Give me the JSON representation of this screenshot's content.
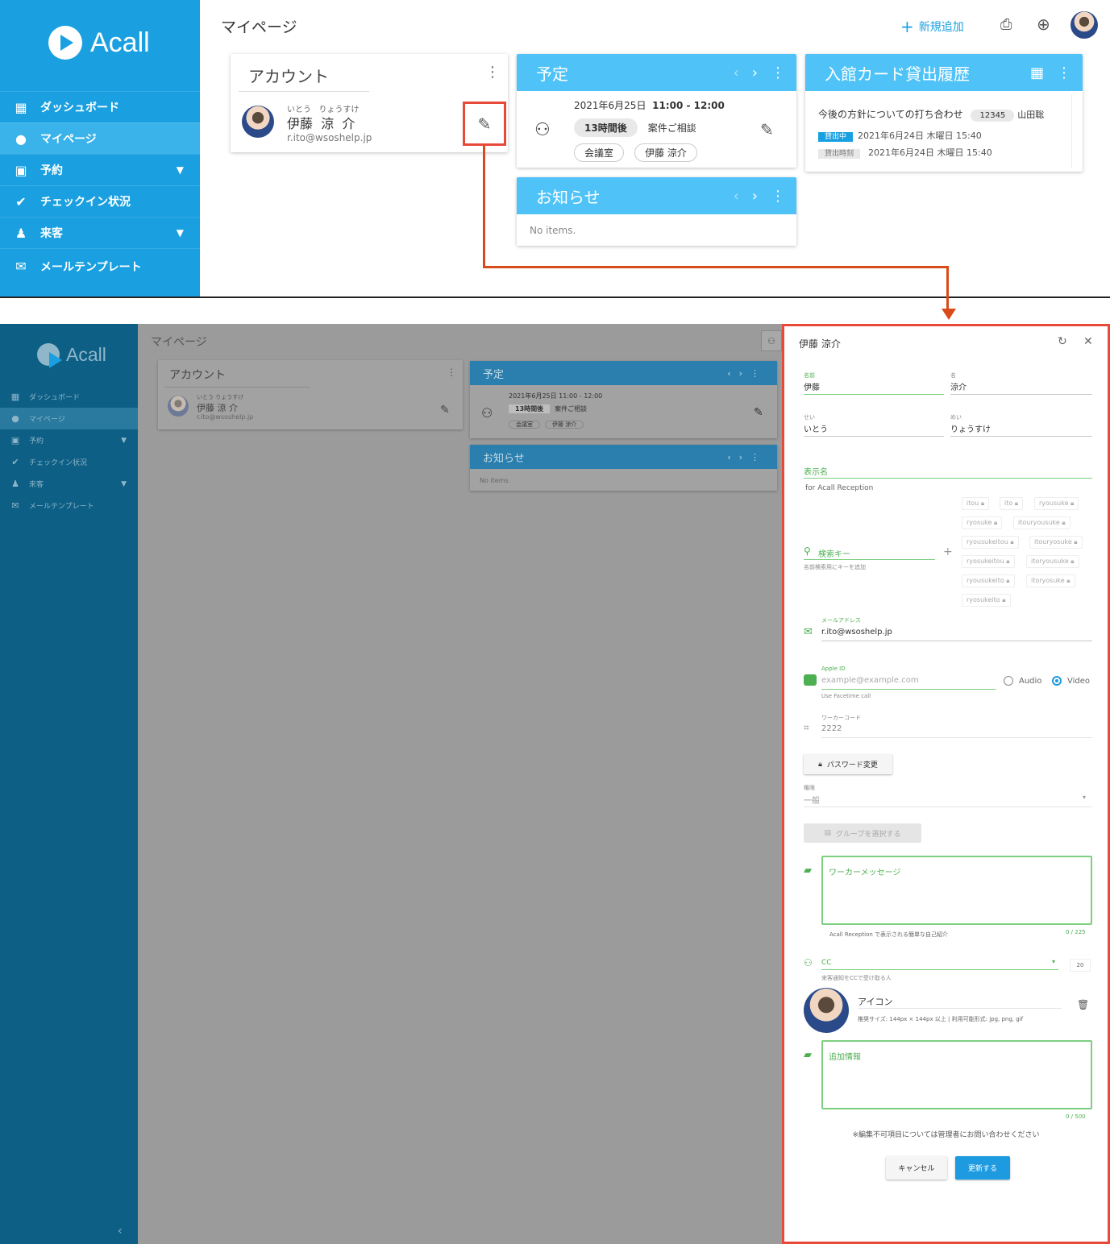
{
  "app": {
    "brand": "Acall",
    "page_title": "マイページ"
  },
  "header": {
    "new_label": "新規追加"
  },
  "sidebar": {
    "items": [
      {
        "label": "ダッシュボード",
        "icon": "dashboard-icon"
      },
      {
        "label": "マイページ",
        "icon": "account-icon"
      },
      {
        "label": "予約",
        "icon": "calendar-icon"
      },
      {
        "label": "チェックイン状況",
        "icon": "check-icon"
      },
      {
        "label": "来客",
        "icon": "visitor-icon"
      },
      {
        "label": "メールテンプレート",
        "icon": "mail-icon"
      }
    ]
  },
  "account": {
    "title": "アカウント",
    "kana_last": "いとう",
    "kana_first": "りょうすけ",
    "name_last": "伊藤",
    "name_first": "涼",
    "name_first2": "介",
    "email": "r.ito@wsoshelp.jp"
  },
  "schedule": {
    "title": "予定",
    "date": "2021年6月25日",
    "time": "11:00 - 12:00",
    "badge": "13時間後",
    "subject": "案件ご相談",
    "room": "会議室",
    "person": "伊藤 涼介"
  },
  "notice": {
    "title": "お知らせ",
    "empty": "No items."
  },
  "card_history": {
    "title": "入館カード貸出履歴",
    "meeting": "今後の方針についての打ち合わせ",
    "card_no": "12345",
    "person": "山田聡",
    "status": "貸出中",
    "status_date": "2021年6月24日 木曜日 15:40",
    "lend_label": "貸出時刻",
    "lend_date": "2021年6月24日 木曜日 15:40"
  },
  "dim_account": {
    "kana": "いとう りょうすけ",
    "name": "伊藤 涼 介",
    "schedule_datetime": "2021年6月25日 11:00 - 12:00",
    "room": "会議室",
    "person": "伊藤 涼介"
  },
  "form": {
    "title": "伊藤 涼介",
    "last_label": "名前",
    "last_value": "伊藤",
    "first_label": "名",
    "first_value": "涼介",
    "sei_label": "せい",
    "sei_value": "いとう",
    "mei_label": "めい",
    "mei_value": "りょうすけ",
    "display_label": "表示名",
    "display_hint": "for Acall Reception",
    "search_label": "検索キー",
    "search_hint": "名前検索用にキーを追加",
    "search_keys": [
      "itou",
      "ito",
      "ryousuke",
      "ryosuke",
      "itouryousuke",
      "ryousukeitou",
      "itouryosuke",
      "ryosukeitou",
      "itoryousuke",
      "ryousukeito",
      "itoryosuke",
      "ryosukeito"
    ],
    "email_label": "メールアドレス",
    "email_value": "r.ito@wsoshelp.jp",
    "apple_label": "Apple ID",
    "apple_placeholder": "example@example.com",
    "apple_hint": "Use Facetime call",
    "audio_label": "Audio",
    "video_label": "Video",
    "worker_label": "ワーカーコード",
    "worker_value": "2222",
    "password_label": "パスワード変更",
    "role_label": "権限",
    "role_value": "一般",
    "group_label": "グループを選択する",
    "message_label": "ワーカーメッセージ",
    "message_hint": "Acall Reception で表示される簡単な自己紹介",
    "message_counter": "0 / 225",
    "cc_label": "CC",
    "cc_hint": "来客通知をCCで受け取る人",
    "cc_count": "20",
    "icon_label": "アイコン",
    "icon_hint": "推奨サイズ: 144px × 144px 以上 | 利用可能形式: jpg, png, gif",
    "extra_label": "追加情報",
    "extra_counter": "0 / 500",
    "note": "※編集不可項目については管理者にお問い合わせください",
    "cancel": "キャンセル",
    "submit": "更新する"
  },
  "colors": {
    "primary": "#1aa0e0",
    "card_header": "#4fc3f7",
    "highlight": "#e84a3a",
    "success": "#4caf50",
    "button": "#1e9ae0"
  }
}
